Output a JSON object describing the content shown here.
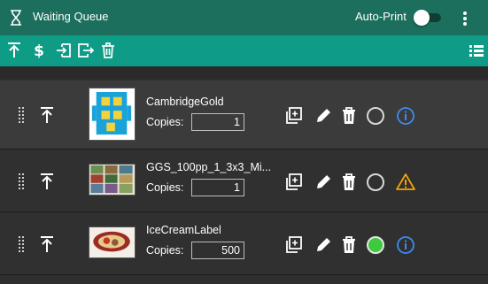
{
  "app": {
    "title": "Waiting Queue",
    "auto_print_label": "Auto-Print",
    "auto_print_on": false
  },
  "toolbar": {
    "icons": [
      "move-to-top-icon",
      "dollar-icon",
      "import-icon",
      "export-icon",
      "trash-icon",
      "list-view-icon"
    ]
  },
  "queue": [
    {
      "name": "CambridgeGold",
      "copies_label": "Copies:",
      "copies": "1",
      "status": "empty",
      "info": "info"
    },
    {
      "name": "GGS_100pp_1_3x3_Mi...",
      "copies_label": "Copies:",
      "copies": "1",
      "status": "empty",
      "info": "warning"
    },
    {
      "name": "IceCreamLabel",
      "copies_label": "Copies:",
      "copies": "500",
      "status": "green",
      "info": "info"
    }
  ],
  "colors": {
    "titlebar": "#1c6f5c",
    "toolbar": "#0f9c86",
    "info_blue": "#3d8bf2",
    "warning_orange": "#f2a20c",
    "status_green": "#3ec93e"
  }
}
